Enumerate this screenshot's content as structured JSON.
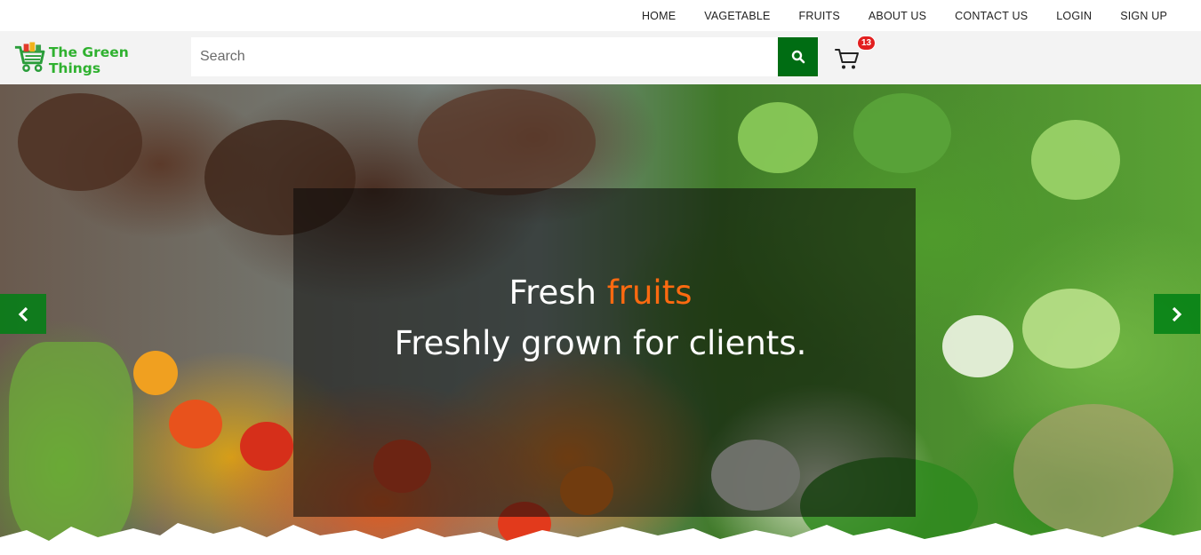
{
  "topnav": {
    "items": [
      "HOME",
      "VAGETABLE",
      "FRUITS",
      "ABOUT US",
      "CONTACT US",
      "LOGIN",
      "SIGN UP"
    ]
  },
  "header": {
    "logo_text": "The Green Things",
    "search_placeholder": "Search",
    "cart_count": "13"
  },
  "hero": {
    "line1_prefix": "Fresh",
    "line1_accent": "fruits",
    "line2": "Freshly grown for clients.",
    "accent_color": "#ff6a10"
  },
  "colors": {
    "brand_green": "#2fb12f",
    "search_button": "#006d13",
    "arrow_bg": "#008014",
    "badge": "#e21f1f"
  },
  "icons": [
    "cart-logo-icon",
    "search-icon",
    "cart-icon",
    "chevron-left-icon",
    "chevron-right-icon"
  ]
}
